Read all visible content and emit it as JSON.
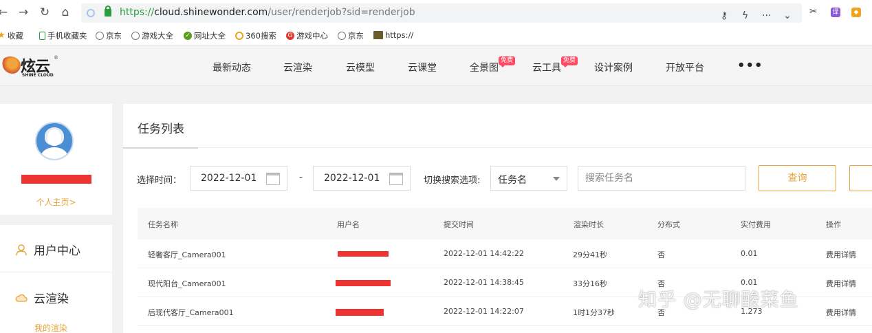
{
  "browser": {
    "url_proto": "https://",
    "url_host": "cloud.shinewonder.com",
    "url_path": "/user/renderjob?sid=renderjob",
    "bookmarks": [
      {
        "label": "收藏",
        "icon": "star-icon"
      },
      {
        "label": "手机收藏夹",
        "icon": "phone-icon"
      },
      {
        "label": "京东",
        "icon": "globe-icon"
      },
      {
        "label": "游戏大全",
        "icon": "globe-icon"
      },
      {
        "label": "网址大全",
        "icon": "portal-icon"
      },
      {
        "label": "360搜索",
        "icon": "search-360-icon"
      },
      {
        "label": "游戏中心",
        "icon": "game-center-icon"
      },
      {
        "label": "京东",
        "icon": "globe-icon"
      },
      {
        "label": "https://",
        "icon": "page-thumb-icon"
      }
    ]
  },
  "site": {
    "logo_text": "炫云",
    "logo_sub": "SHINE CLOUD",
    "logo_reg": "®",
    "nav": [
      {
        "label": "最新动态"
      },
      {
        "label": "云渲染"
      },
      {
        "label": "云模型"
      },
      {
        "label": "云课堂"
      },
      {
        "label": "全景图",
        "badge": "免费"
      },
      {
        "label": "云工具",
        "badge": "免费"
      },
      {
        "label": "设计案例"
      },
      {
        "label": "开放平台"
      }
    ],
    "more": "•••"
  },
  "sidebar": {
    "profile_link": "个人主页>",
    "menu": [
      {
        "label": "用户中心",
        "icon": "user-icon"
      },
      {
        "label": "云渲染",
        "icon": "cloud-icon"
      }
    ],
    "submenu_label": "我的渲染"
  },
  "main": {
    "tab_title": "任务列表",
    "filter": {
      "time_label": "选择时间：",
      "date_from": "2022-12-01",
      "date_to": "2022-12-01",
      "dash": "-",
      "search_option_label": "切换搜索选项:",
      "search_option_value": "任务名",
      "search_placeholder": "搜索任务名",
      "query_button": "查询"
    },
    "table": {
      "headers": [
        "任务名称",
        "用户名",
        "提交时间",
        "渲染时长",
        "分布式",
        "实付费用",
        "操作"
      ],
      "rows": [
        {
          "name": "轻奢客厅_Camera001",
          "time": "2022-12-01 14:42:22",
          "duration": "29分41秒",
          "distributed": "否",
          "fee": "0.01",
          "action": "费用详情"
        },
        {
          "name": "现代阳台_Camera001",
          "time": "2022-12-01 14:38:45",
          "duration": "33分16秒",
          "distributed": "否",
          "fee": "0.01",
          "action": "费用详情"
        },
        {
          "name": "后现代客厅_Camera001",
          "time": "2022-12-01 14:22:07",
          "duration": "1时1分37秒",
          "distributed": "否",
          "fee": "1.273",
          "action": "费用详情"
        }
      ]
    }
  },
  "watermark": "知乎 @无聊酸菜鱼",
  "colors": {
    "accent": "#e8a437",
    "redaction": "#ee3333",
    "secure_green": "#2e9c3e"
  }
}
